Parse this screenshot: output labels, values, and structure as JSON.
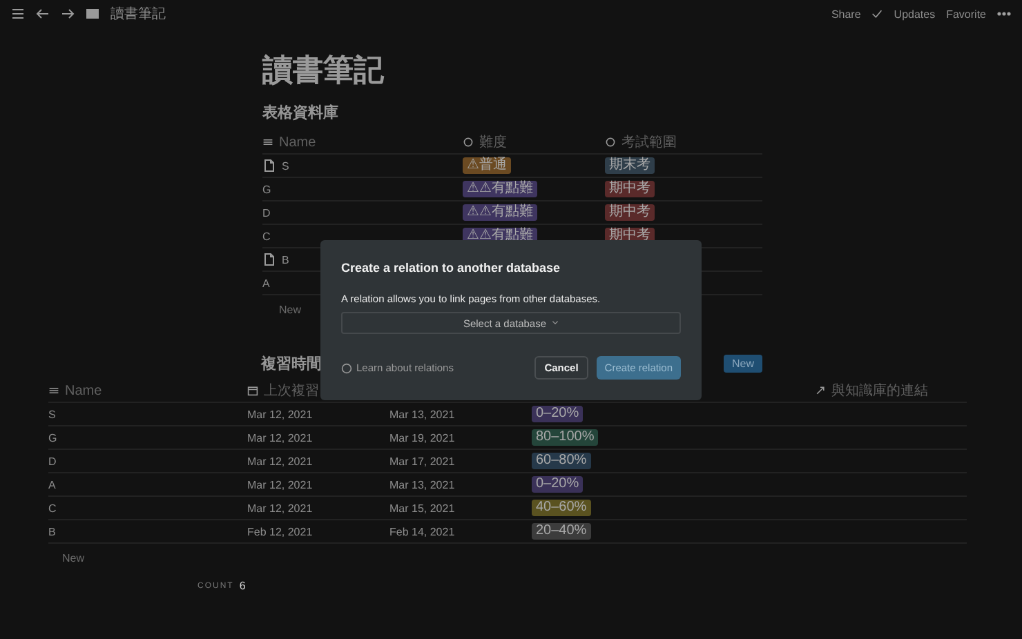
{
  "topbar": {
    "breadcrumb": "讀書筆記",
    "actions": [
      "Share",
      "Updates",
      "Favorite"
    ]
  },
  "title": "讀書筆記",
  "table1": {
    "heading": "表格資料庫",
    "columns": [
      "Name",
      "難度",
      "考試範圍"
    ],
    "rows": [
      {
        "name": "S",
        "page": true,
        "tags": [
          {
            "text": "⚠普通",
            "color": "#6b4a22"
          },
          {
            "text": "期末考",
            "color": "#2f3e4a"
          }
        ]
      },
      {
        "name": "G",
        "page": false,
        "tags": [
          {
            "text": "⚠⚠有點難",
            "color": "#3f3560"
          },
          {
            "text": "期中考",
            "color": "#5a2a2a"
          }
        ]
      },
      {
        "name": "D",
        "page": false,
        "tags": [
          {
            "text": "⚠⚠有點難",
            "color": "#3f3560"
          },
          {
            "text": "期中考",
            "color": "#5a2a2a"
          }
        ]
      },
      {
        "name": "C",
        "page": false,
        "tags": [
          {
            "text": "⚠⚠有點難",
            "color": "#3f3560"
          },
          {
            "text": "期中考",
            "color": "#5a2a2a"
          }
        ]
      },
      {
        "name": "B",
        "page": true,
        "tags": []
      },
      {
        "name": "A",
        "page": false,
        "tags": []
      }
    ],
    "new_label": "New"
  },
  "table2": {
    "heading": "複習時間",
    "new_button": "New",
    "columns": [
      {
        "label": "Name"
      },
      {
        "label": "上次複習"
      },
      {
        "label": "與知識庫的連結"
      }
    ],
    "rows": [
      {
        "name": "S",
        "last": "Mar 12, 2021",
        "next": "Mar 13, 2021",
        "tag": {
          "text": "0–20%",
          "color": "#3a3158"
        }
      },
      {
        "name": "G",
        "last": "Mar 12, 2021",
        "next": "Mar 19, 2021",
        "tag": {
          "text": "80–100%",
          "color": "#24453a"
        }
      },
      {
        "name": "D",
        "last": "Mar 12, 2021",
        "next": "Mar 17, 2021",
        "tag": {
          "text": "60–80%",
          "color": "#26394a"
        }
      },
      {
        "name": "A",
        "last": "Mar 12, 2021",
        "next": "Mar 13, 2021",
        "tag": {
          "text": "0–20%",
          "color": "#3a3158"
        }
      },
      {
        "name": "C",
        "last": "Mar 12, 2021",
        "next": "Mar 15, 2021",
        "tag": {
          "text": "40–60%",
          "color": "#5a5220"
        }
      },
      {
        "name": "B",
        "last": "Feb 12, 2021",
        "next": "Feb 14, 2021",
        "tag": {
          "text": "20–40%",
          "color": "#3c3c3c"
        }
      }
    ],
    "new_label": "New",
    "count_label": "COUNT",
    "count": "6"
  },
  "dialog": {
    "title": "Create a relation to another database",
    "text": "A relation allows you to link pages from other databases.",
    "select": "Select a database",
    "help": "Learn about relations",
    "cancel": "Cancel",
    "confirm": "Create relation"
  }
}
